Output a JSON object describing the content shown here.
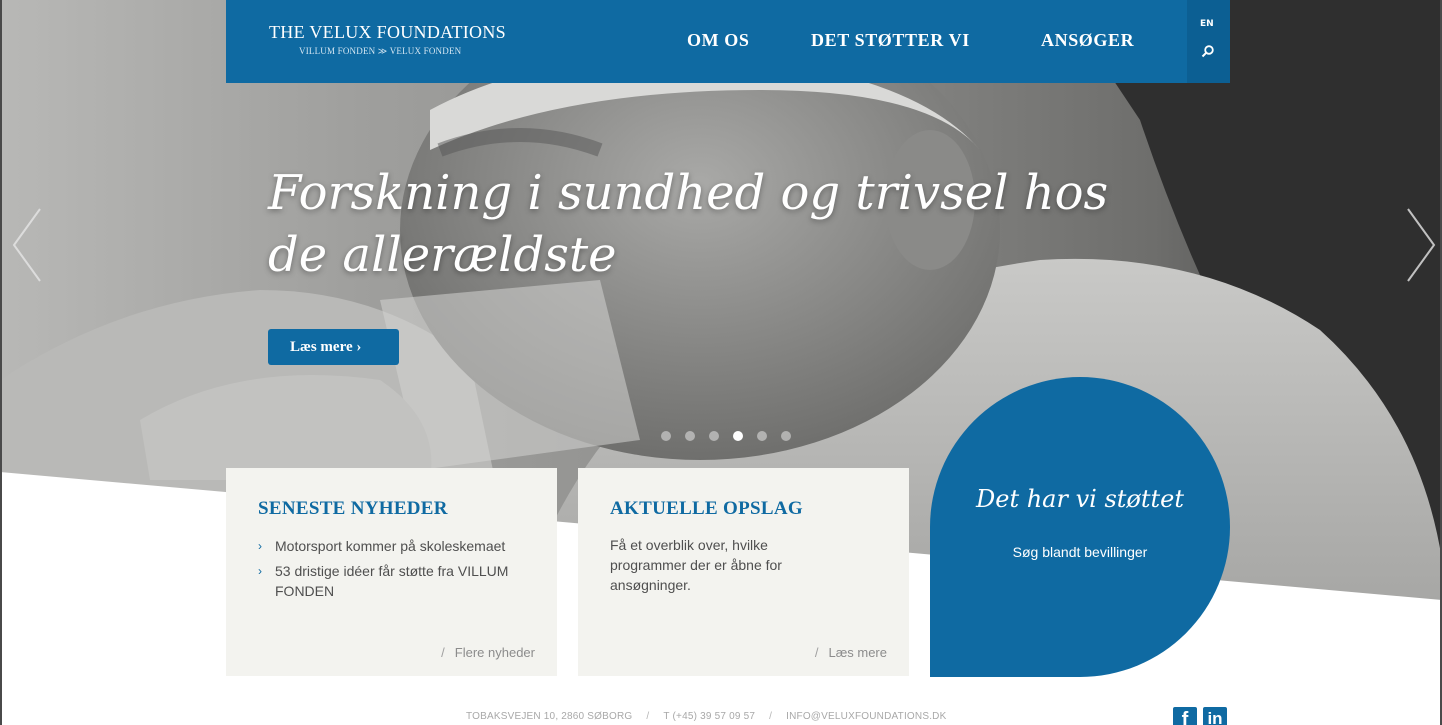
{
  "header": {
    "logo_title": "THE VELUX FOUNDATIONS",
    "logo_subtitle": "VILLUM FONDEN ≫ VELUX FONDEN",
    "nav": [
      {
        "label": "OM OS"
      },
      {
        "label": "DET STØTTER VI"
      },
      {
        "label": "ANSØGER"
      }
    ],
    "language": "EN",
    "search_icon": "search-icon"
  },
  "hero": {
    "title": "Forskning i sundhed og trivsel hos de allerældste",
    "cta_label": "Læs mere ›",
    "slide_count": 6,
    "active_slide": 4,
    "prev_icon": "chevron-left-icon",
    "next_icon": "chevron-right-icon"
  },
  "news": {
    "title": "SENESTE NYHEDER",
    "items": [
      "Motorsport kommer på skoleskemaet",
      "53 dristige idéer får støtte fra VILLUM FONDEN"
    ],
    "more_label": "Flere nyheder"
  },
  "calls": {
    "title": "AKTUELLE OPSLAG",
    "text": "Få et overblik over, hvilke programmer der er åbne for ansøgninger.",
    "more_label": "Læs mere"
  },
  "supported": {
    "title": "Det har vi støttet",
    "link": "Søg blandt bevillinger"
  },
  "footer": {
    "address": "TOBAKSVEJEN 10, 2860 SØBORG",
    "phone": "T (+45) 39 57 09 57",
    "email": "INFO@VELUXFOUNDATIONS.DK",
    "separator": "/",
    "facebook_label": "f",
    "linkedin_label": "in"
  },
  "colors": {
    "brand_blue": "#0f6aa2",
    "card_bg": "#f3f3ef"
  }
}
